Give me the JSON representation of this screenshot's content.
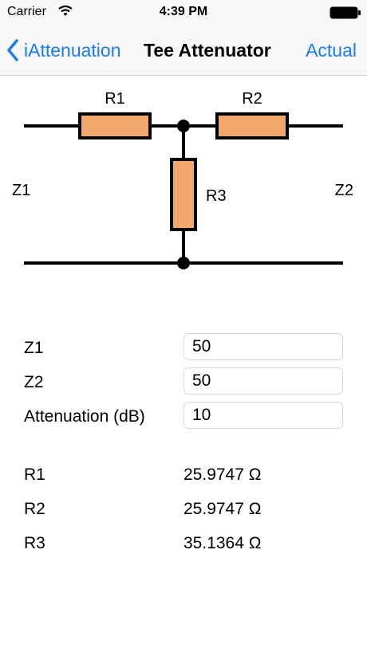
{
  "status_bar": {
    "carrier": "Carrier",
    "time": "4:39 PM"
  },
  "nav": {
    "back_label": "iAttenuation",
    "title": "Tee Attenuator",
    "action_label": "Actual"
  },
  "diagram": {
    "r1_label": "R1",
    "r2_label": "R2",
    "r3_label": "R3",
    "z1_label": "Z1",
    "z2_label": "Z2",
    "resistor_color": "#f2a86a"
  },
  "form": {
    "z1": {
      "label": "Z1",
      "value": "50"
    },
    "z2": {
      "label": "Z2",
      "value": "50"
    },
    "attenuation": {
      "label": "Attenuation (dB)",
      "value": "10"
    }
  },
  "results": [
    {
      "label": "R1",
      "value": "25.9747 Ω"
    },
    {
      "label": "R2",
      "value": "25.9747 Ω"
    },
    {
      "label": "R3",
      "value": "35.1364 Ω"
    }
  ]
}
